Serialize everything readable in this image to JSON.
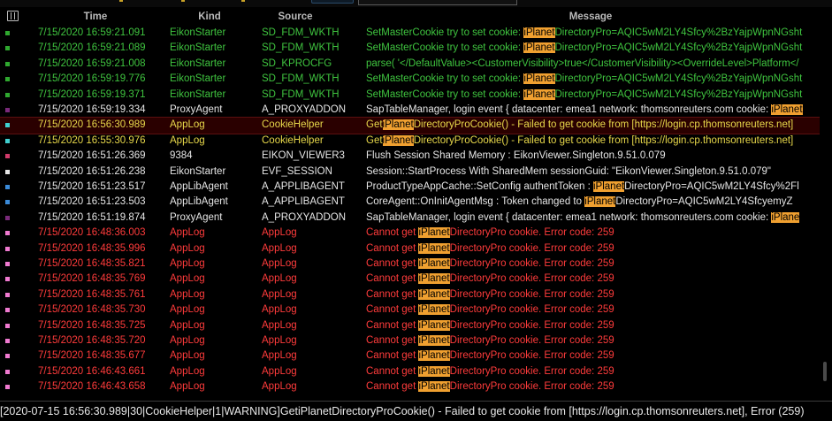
{
  "colors": {
    "green": "#3fc43f",
    "yellow": "#e8d84a",
    "red": "#ff3b3b",
    "white": "#e6e6e6",
    "highlight": "#f0a030",
    "selected_row_bg": "#2a0000"
  },
  "columns": {
    "time": "Time",
    "kind": "Kind",
    "source": "Source",
    "message": "Message"
  },
  "highlight_term": "iPlanet",
  "rows": [
    {
      "marker": "#2fa82f",
      "color": "#3fc43f",
      "time": "7/15/2020 16:59:21.091",
      "kind": "EikonStarter",
      "source": "SD_FDM_WKTH",
      "message": "SetMasterCookie try to set cookie: iPlanetDirectoryPro=AQIC5wM2LY4Sfcy%2BzYajpWpnNGsht"
    },
    {
      "marker": "#2fa82f",
      "color": "#3fc43f",
      "time": "7/15/2020 16:59:21.089",
      "kind": "EikonStarter",
      "source": "SD_FDM_WKTH",
      "message": "SetMasterCookie try to set cookie: iPlanetDirectoryPro=AQIC5wM2LY4Sfcy%2BzYajpWpnNGsht"
    },
    {
      "marker": "#2fa82f",
      "color": "#3fc43f",
      "time": "7/15/2020 16:59:21.008",
      "kind": "EikonStarter",
      "source": "SD_KPROCFG",
      "message": "parse( '</DefaultValue><CustomerVisibility>true</CustomerVisibility><OverrideLevel>Platform</"
    },
    {
      "marker": "#2fa82f",
      "color": "#3fc43f",
      "time": "7/15/2020 16:59:19.776",
      "kind": "EikonStarter",
      "source": "SD_FDM_WKTH",
      "message": "SetMasterCookie try to set cookie: iPlanetDirectoryPro=AQIC5wM2LY4Sfcy%2BzYajpWpnNGsht"
    },
    {
      "marker": "#2fa82f",
      "color": "#3fc43f",
      "time": "7/15/2020 16:59:19.371",
      "kind": "EikonStarter",
      "source": "SD_FDM_WKTH",
      "message": "SetMasterCookie try to set cookie: iPlanetDirectoryPro=AQIC5wM2LY4Sfcy%2BzYajpWpnNGsht"
    },
    {
      "marker": "#7a2a7a",
      "color": "#e6e6e6",
      "time": "7/15/2020 16:59:19.334",
      "kind": "ProxyAgent",
      "source": "A_PROXYADDON",
      "message": "SapTableManager, login event { datacenter: emea1 network: thomsonreuters.com cookie: iPlanet"
    },
    {
      "marker": "#40d0d0",
      "color": "#e8d84a",
      "time": "7/15/2020 16:56:30.989",
      "kind": "AppLog",
      "source": "CookieHelper",
      "message": "GetiPlanetDirectoryProCookie() - Failed to get cookie from [https://login.cp.thomsonreuters.net]",
      "selected": true
    },
    {
      "marker": "#40d0d0",
      "color": "#e8d84a",
      "time": "7/15/2020 16:55:30.976",
      "kind": "AppLog",
      "source": "CookieHelper",
      "message": "GetiPlanetDirectoryProCookie() - Failed to get cookie from [https://login.cp.thomsonreuters.net]"
    },
    {
      "marker": "#d03a6a",
      "color": "#e6e6e6",
      "time": "7/15/2020 16:51:26.369",
      "kind": "9384",
      "source": "EIKON_VIEWER3",
      "message": "Flush Session Shared Memory : EikonViewer.Singleton.9.51.0.079"
    },
    {
      "marker": "#e6e6e6",
      "color": "#e6e6e6",
      "time": "7/15/2020 16:51:26.238",
      "kind": "EikonStarter",
      "source": "EVF_SESSION",
      "message": "Session::StartProcess With SharedMem sessionGuid: \"EikonViewer.Singleton.9.51.0.079\""
    },
    {
      "marker": "#3a8ad8",
      "color": "#e6e6e6",
      "time": "7/15/2020 16:51:23.517",
      "kind": "AppLibAgent",
      "source": "A_APPLIBAGENT",
      "message": "ProductTypeAppCache::SetConfig authentToken : iPlanetDirectoryPro=AQIC5wM2LY4Sfcy%2Fl"
    },
    {
      "marker": "#3a8ad8",
      "color": "#e6e6e6",
      "time": "7/15/2020 16:51:23.503",
      "kind": "AppLibAgent",
      "source": "A_APPLIBAGENT",
      "message": "CoreAgent::OnInitAgentMsg : Token changed to iPlanetDirectoryPro=AQIC5wM2LY4SfcyemyZ"
    },
    {
      "marker": "#7a2a7a",
      "color": "#e6e6e6",
      "time": "7/15/2020 16:51:19.874",
      "kind": "ProxyAgent",
      "source": "A_PROXYADDON",
      "message": "SapTableManager, login event { datacenter: emea1 network: thomsonreuters.com cookie: iPlane"
    },
    {
      "marker": "#f07ad0",
      "color": "#ff3b3b",
      "time": "7/15/2020 16:48:36.003",
      "kind": "AppLog",
      "source": "AppLog",
      "message": "Cannot get iPlanetDirectoryPro cookie. Error code: 259"
    },
    {
      "marker": "#f07ad0",
      "color": "#ff3b3b",
      "time": "7/15/2020 16:48:35.996",
      "kind": "AppLog",
      "source": "AppLog",
      "message": "Cannot get iPlanetDirectoryPro cookie. Error code: 259"
    },
    {
      "marker": "#f07ad0",
      "color": "#ff3b3b",
      "time": "7/15/2020 16:48:35.821",
      "kind": "AppLog",
      "source": "AppLog",
      "message": "Cannot get iPlanetDirectoryPro cookie. Error code: 259"
    },
    {
      "marker": "#f07ad0",
      "color": "#ff3b3b",
      "time": "7/15/2020 16:48:35.769",
      "kind": "AppLog",
      "source": "AppLog",
      "message": "Cannot get iPlanetDirectoryPro cookie. Error code: 259"
    },
    {
      "marker": "#f07ad0",
      "color": "#ff3b3b",
      "time": "7/15/2020 16:48:35.761",
      "kind": "AppLog",
      "source": "AppLog",
      "message": "Cannot get iPlanetDirectoryPro cookie. Error code: 259"
    },
    {
      "marker": "#f07ad0",
      "color": "#ff3b3b",
      "time": "7/15/2020 16:48:35.730",
      "kind": "AppLog",
      "source": "AppLog",
      "message": "Cannot get iPlanetDirectoryPro cookie. Error code: 259"
    },
    {
      "marker": "#f07ad0",
      "color": "#ff3b3b",
      "time": "7/15/2020 16:48:35.725",
      "kind": "AppLog",
      "source": "AppLog",
      "message": "Cannot get iPlanetDirectoryPro cookie. Error code: 259"
    },
    {
      "marker": "#f07ad0",
      "color": "#ff3b3b",
      "time": "7/15/2020 16:48:35.720",
      "kind": "AppLog",
      "source": "AppLog",
      "message": "Cannot get iPlanetDirectoryPro cookie. Error code: 259"
    },
    {
      "marker": "#f07ad0",
      "color": "#ff3b3b",
      "time": "7/15/2020 16:48:35.677",
      "kind": "AppLog",
      "source": "AppLog",
      "message": "Cannot get iPlanetDirectoryPro cookie. Error code: 259"
    },
    {
      "marker": "#f07ad0",
      "color": "#ff3b3b",
      "time": "7/15/2020 16:46:43.661",
      "kind": "AppLog",
      "source": "AppLog",
      "message": "Cannot get iPlanetDirectoryPro cookie. Error code: 259"
    },
    {
      "marker": "#f07ad0",
      "color": "#ff3b3b",
      "time": "7/15/2020 16:46:43.658",
      "kind": "AppLog",
      "source": "AppLog",
      "message": "Cannot get iPlanetDirectoryPro cookie. Error code: 259"
    }
  ],
  "status_bar": {
    "text": "[2020-07-15 16:56:30.989|30|CookieHelper|1|WARNING]GetiPlanetDirectoryProCookie() - Failed to get cookie from [https://login.cp.thomsonreuters.net], Error (259)"
  }
}
